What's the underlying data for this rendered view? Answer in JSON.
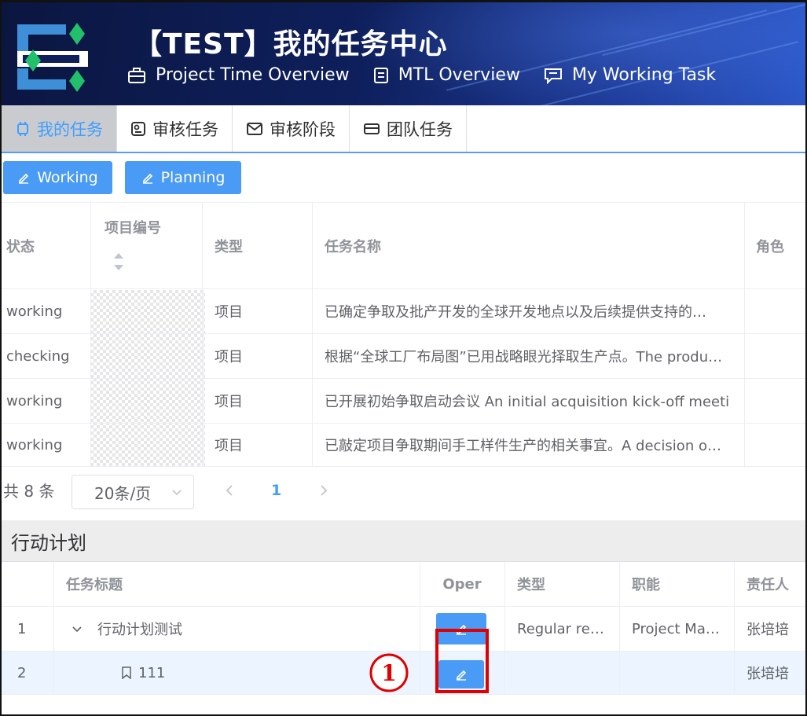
{
  "app": {
    "title": "【TEST】我的任务中心",
    "nav": [
      {
        "label": "Project Time Overview",
        "icon": "briefcase-icon"
      },
      {
        "label": "MTL Overview",
        "icon": "document-icon"
      },
      {
        "label": "My Working Task",
        "icon": "message-icon"
      }
    ]
  },
  "tabs": [
    {
      "label": "我的任务",
      "icon": "cpu-icon",
      "active": true
    },
    {
      "label": "审核任务",
      "icon": "review-icon"
    },
    {
      "label": "审核阶段",
      "icon": "mail-icon"
    },
    {
      "label": "团队任务",
      "icon": "card-icon"
    }
  ],
  "toolbar": {
    "working_label": "Working",
    "planning_label": "Planning",
    "icon": "edit-icon"
  },
  "task_table": {
    "columns": [
      "状态",
      "项目编号",
      "类型",
      "任务名称",
      "角色"
    ],
    "rows": [
      {
        "status": "working",
        "project_no": "",
        "type": "项目",
        "name": "已确定争取及批产开发的全球开发地点以及后续提供支持的…",
        "role": ""
      },
      {
        "status": "checking",
        "project_no": "",
        "type": "项目",
        "name": "根据“全球工厂布局图”已用战略眼光择取生产点。The produ…",
        "role": ""
      },
      {
        "status": "working",
        "project_no": "",
        "type": "项目",
        "name": "已开展初始争取启动会议 An initial acquisition kick-off meeti…",
        "role": ""
      },
      {
        "status": "working",
        "project_no": "",
        "type": "项目",
        "name": "已敲定项目争取期间手工样件生产的相关事宜。A decision o…",
        "role": ""
      }
    ]
  },
  "pagination": {
    "total": "共 8 条",
    "page_size": "20条/页",
    "current_page": "1"
  },
  "action_plan": {
    "title": "行动计划",
    "columns": [
      "任务标题",
      "Oper",
      "类型",
      "职能",
      "责任人"
    ],
    "rows": [
      {
        "index": "1",
        "title": "行动计划测试",
        "type": "Regular re…",
        "function": "Project Ma…",
        "owner": "张培培"
      },
      {
        "index": "2",
        "title": "111",
        "type": "",
        "function": "",
        "owner": "张培培"
      }
    ]
  },
  "annotation": {
    "marker": "①",
    "color": "#e00000"
  },
  "colors": {
    "primary": "#409eff",
    "button": "#4a9bf5",
    "header_dark": "#0b1640"
  }
}
